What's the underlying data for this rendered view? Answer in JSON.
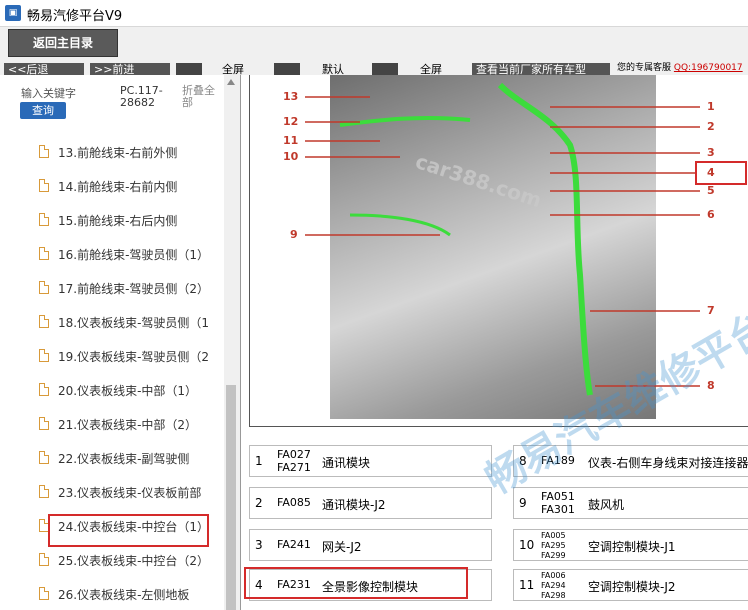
{
  "window": {
    "title": "畅易汽修平台V9"
  },
  "toolbar": {
    "home_label": "返回主目录",
    "back_label": "<<后退",
    "forward_label": ">>前进",
    "label_all": "全屏",
    "label_default": "默认",
    "label_all2": "全屏",
    "banner": "查看当前厂家所有车型",
    "service_text": "您的专属客服",
    "qq": "QQ:196790017"
  },
  "sidebar": {
    "keyword_label": "输入关键字",
    "keyword_value": "PC.117-28682",
    "fold_label": "折叠全部",
    "query_label": "查询",
    "items": [
      {
        "label": "13.前舱线束-右前外侧"
      },
      {
        "label": "14.前舱线束-右前内侧"
      },
      {
        "label": "15.前舱线束-右后内侧"
      },
      {
        "label": "16.前舱线束-驾驶员侧（1）"
      },
      {
        "label": "17.前舱线束-驾驶员侧（2）"
      },
      {
        "label": "18.仪表板线束-驾驶员侧（1"
      },
      {
        "label": "19.仪表板线束-驾驶员侧（2"
      },
      {
        "label": "20.仪表板线束-中部（1）"
      },
      {
        "label": "21.仪表板线束-中部（2）"
      },
      {
        "label": "22.仪表板线束-副驾驶侧"
      },
      {
        "label": "23.仪表板线束-仪表板前部"
      },
      {
        "label": "24.仪表板线束-中控台（1）"
      },
      {
        "label": "25.仪表板线束-中控台（2）"
      },
      {
        "label": "26.仪表板线束-左侧地板"
      }
    ]
  },
  "figure": {
    "callouts": [
      "1",
      "2",
      "3",
      "4",
      "5",
      "6",
      "7",
      "8",
      "9",
      "10",
      "11",
      "12",
      "13"
    ],
    "watermark": "畅易汽车维修平台",
    "site": "car388.com"
  },
  "parts": [
    {
      "num": "1",
      "codes": [
        "FA027",
        "FA271"
      ],
      "name": "通讯模块"
    },
    {
      "num": "8",
      "codes": [
        "FA189"
      ],
      "name": "仪表-右侧车身线束对接连接器"
    },
    {
      "num": "2",
      "codes": [
        "FA085"
      ],
      "name": "通讯模块-J2"
    },
    {
      "num": "9",
      "codes": [
        "FA051",
        "FA301"
      ],
      "name": "鼓风机"
    },
    {
      "num": "3",
      "codes": [
        "FA241"
      ],
      "name": "网关-J2"
    },
    {
      "num": "10",
      "codes": [
        "FA005",
        "FA295",
        "FA299"
      ],
      "name": "空调控制模块-J1"
    },
    {
      "num": "4",
      "codes": [
        "FA231"
      ],
      "name": "全景影像控制模块"
    },
    {
      "num": "11",
      "codes": [
        "FA006",
        "FA294",
        "FA298"
      ],
      "name": "空调控制模块-J2"
    }
  ]
}
